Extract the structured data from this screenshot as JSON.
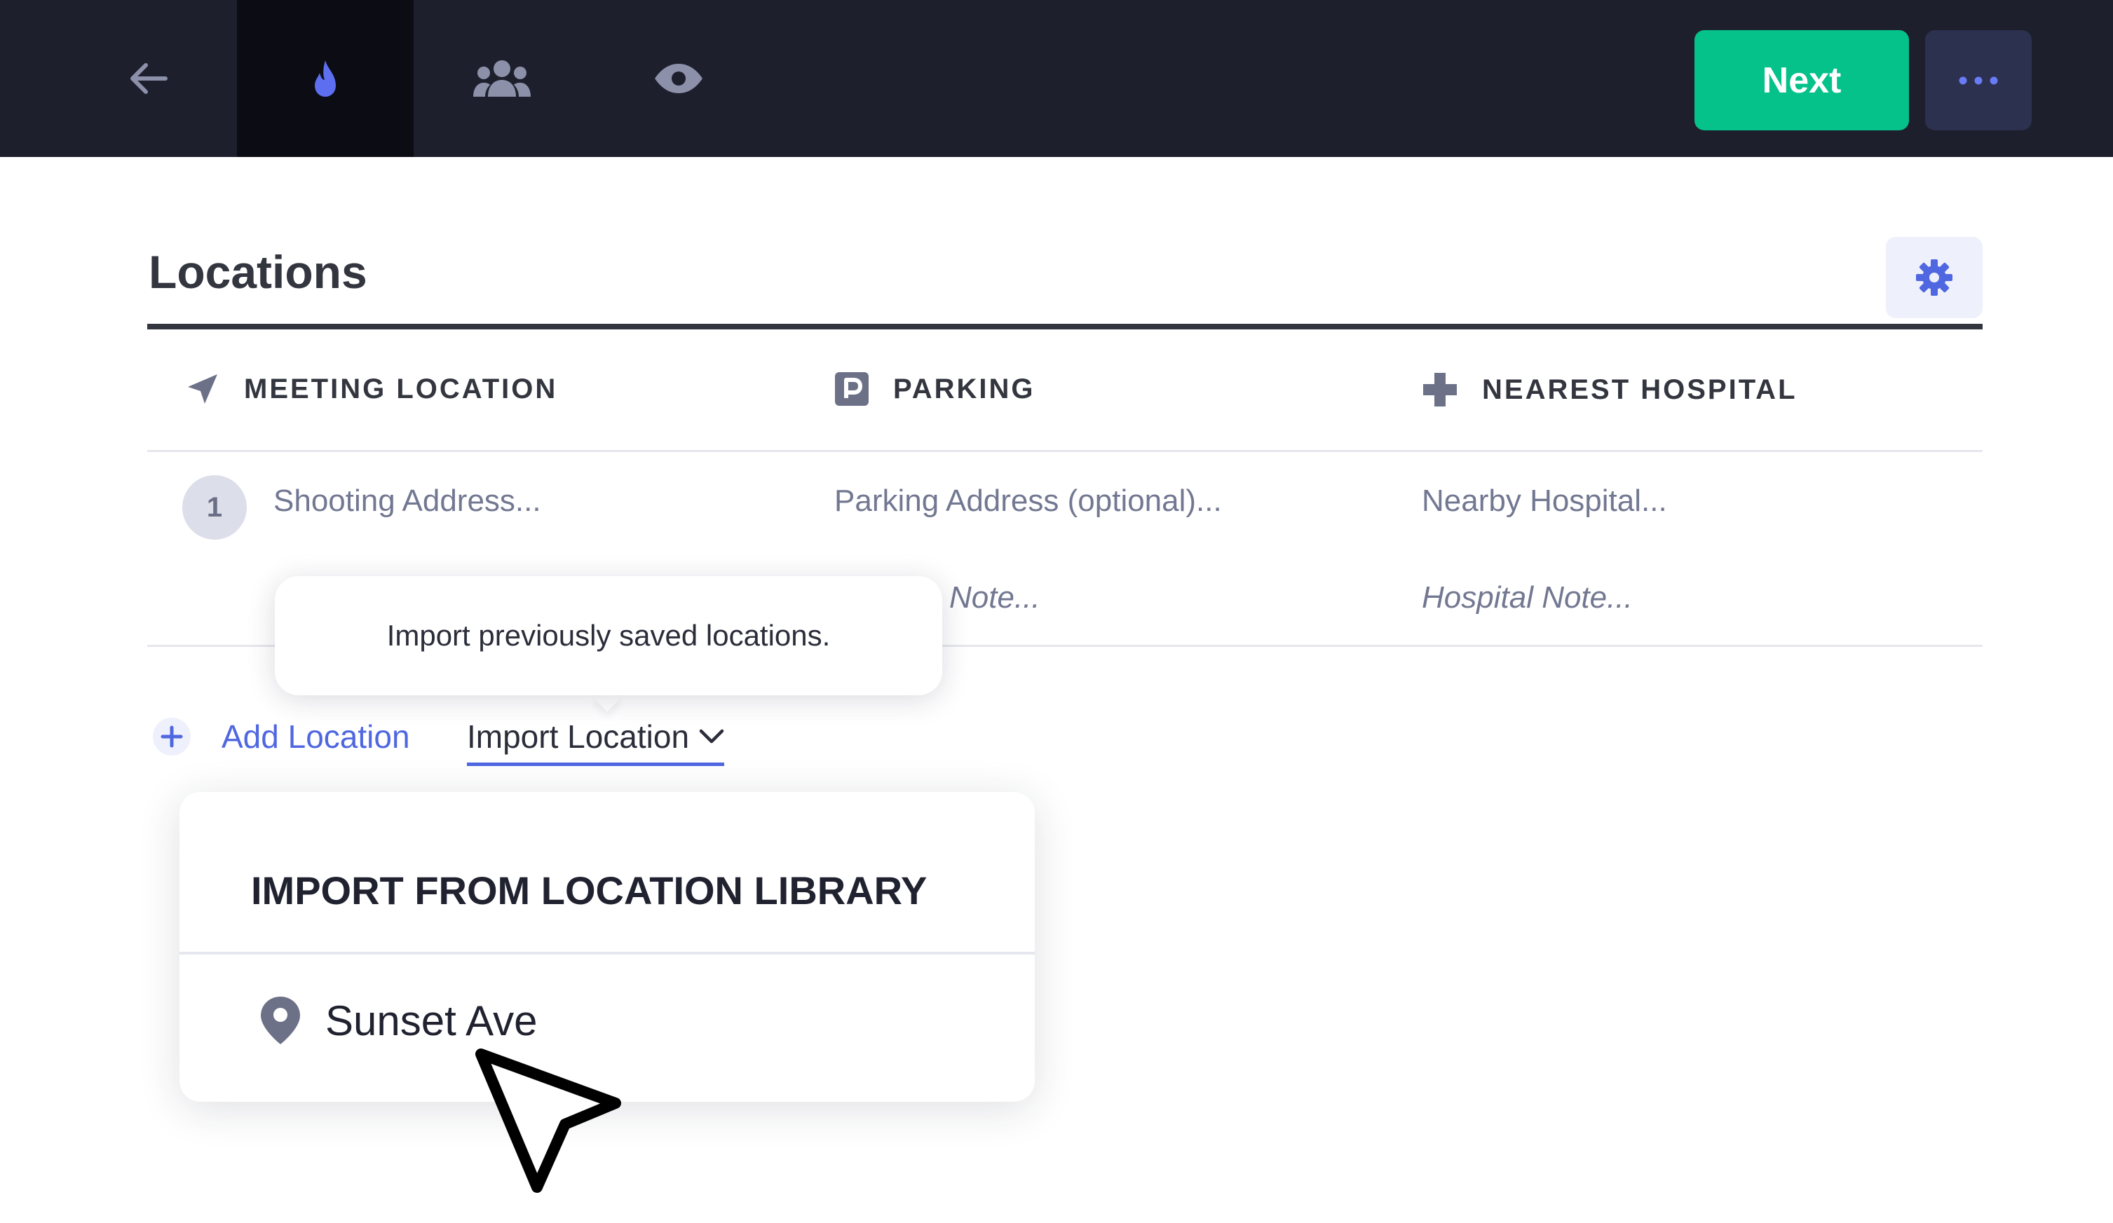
{
  "topbar": {
    "nav": [
      {
        "icon": "arrow-left-icon"
      },
      {
        "icon": "flame-icon",
        "active": true
      },
      {
        "icon": "people-icon"
      },
      {
        "icon": "eye-icon"
      }
    ],
    "next_label": "Next",
    "more_icon": "ellipsis-icon"
  },
  "section": {
    "title": "Locations",
    "settings_icon": "gear-icon"
  },
  "columns": [
    {
      "label": "MEETING LOCATION",
      "icon": "navigation-arrow-icon"
    },
    {
      "label": "PARKING",
      "icon": "parking-icon"
    },
    {
      "label": "NEAREST HOSPITAL",
      "icon": "cross-icon"
    }
  ],
  "row": {
    "number": "1",
    "shooting_placeholder": "Shooting Address...",
    "parking_placeholder": "Parking Address (optional)...",
    "hospital_placeholder": "Nearby Hospital...",
    "parking_note_partial": "Note...",
    "hospital_note": "Hospital Note..."
  },
  "tooltip": {
    "text": "Import previously saved locations."
  },
  "actions": {
    "add_location": "Add Location",
    "import_location": "Import Location"
  },
  "dropdown": {
    "title": "IMPORT FROM LOCATION LIBRARY",
    "items": [
      {
        "label": "Sunset Ave",
        "icon": "map-pin-icon"
      }
    ]
  },
  "colors": {
    "topbar_bg": "#1e1f2d",
    "accent": "#4f67e0",
    "next_green": "#05c18a",
    "icon_gray": "#737892"
  }
}
